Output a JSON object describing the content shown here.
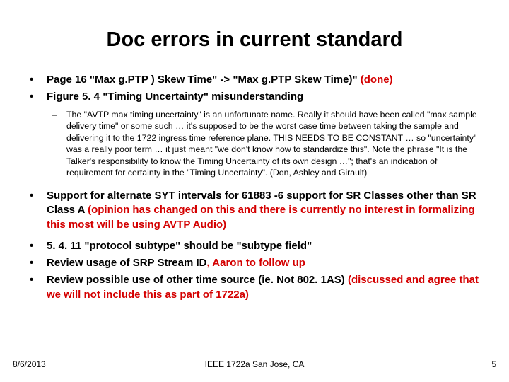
{
  "title": "Doc errors in current standard",
  "bullets": [
    {
      "pre": "Page 16 \"Max g.PTP ) Skew Time\" -> \"Max g.PTP Skew Time)\" ",
      "red": "(done)"
    },
    {
      "pre": "Figure 5. 4 \"Timing Uncertainty\" misunderstanding",
      "red": ""
    }
  ],
  "sub": "The \"AVTP max timing uncertainty\" is an unfortunate name. Really it should have been called \"max sample delivery time\" or some such … it's supposed to be the worst case time between taking the sample and delivering it to the 1722 ingress time reference plane. THIS NEEDS TO BE CONSTANT … so \"uncertainty\" was a really poor term … it just meant \"we don't know how to standardize this\". Note the phrase \"It is the Talker's responsibility to know the Timing Uncertainty of its own design …\"; that's an indication of requirement for certainty in the \"Timing Uncertainty\". (Don, Ashley and Girault)",
  "bullets2": [
    {
      "pre": "Support for alternate SYT intervals for 61883 -6 support for SR Classes other than SR Class A ",
      "red": "(opinion has changed on this and there is currently no interest in formalizing this most will be using AVTP Audio)"
    },
    {
      "pre": "5. 4. 11 \"protocol subtype\" should be \"subtype field\"",
      "red": ""
    },
    {
      "pre": "Review usage of SRP Stream ID",
      "red": ", Aaron to follow up"
    },
    {
      "pre": "Review possible use of other time source (ie. Not 802. 1AS) ",
      "red": "(discussed and agree that we will not include this as part of 1722a)"
    }
  ],
  "footer": {
    "date": "8/6/2013",
    "center": "IEEE 1722a San Jose, CA",
    "page": "5"
  }
}
